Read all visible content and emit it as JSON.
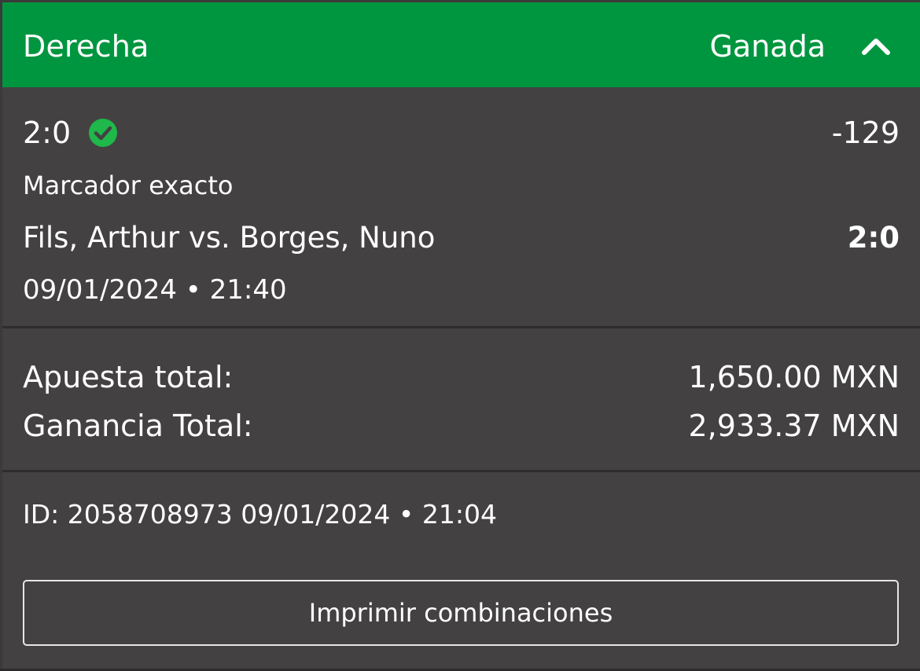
{
  "header": {
    "title": "Derecha",
    "status": "Ganada",
    "toggle_icon": "chevron-up-icon"
  },
  "selection": {
    "pick": "2:0",
    "pick_status_icon": "check-circle-icon",
    "odds": "-129",
    "market": "Marcador exacto",
    "event": "Fils, Arthur vs. Borges, Nuno",
    "final_score": "2:0",
    "event_date": "09/01/2024 • 21:40"
  },
  "totals": {
    "stake_label": "Apuesta total:",
    "stake_value": "1,650.00 MXN",
    "winnings_label": "Ganancia Total:",
    "winnings_value": "2,933.37 MXN"
  },
  "meta": {
    "id_line": "ID: 2058708973  09/01/2024 • 21:04"
  },
  "actions": {
    "print_label": "Imprimir combinaciones"
  },
  "colors": {
    "header_bg": "#00963f",
    "card_bg": "#434142",
    "success": "#1fb84a"
  }
}
